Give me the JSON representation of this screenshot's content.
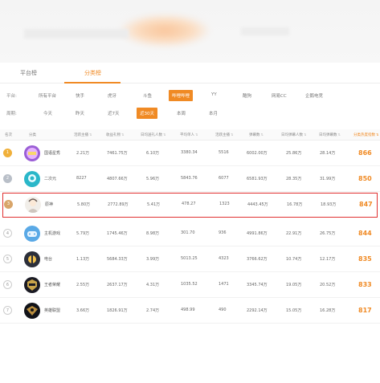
{
  "tabs": [
    {
      "label": "平台榜"
    },
    {
      "label": "分类榜"
    }
  ],
  "platform_filter": {
    "label": "平台:",
    "options": [
      "所有平台",
      "快手",
      "虎牙",
      "斗鱼",
      "哔哩哔哩",
      "YY",
      "酷狗",
      "网易CC",
      "企鹅电竞"
    ],
    "active_index": 4
  },
  "period_filter": {
    "label": "周期:",
    "options": [
      "今天",
      "昨天",
      "近7天",
      "近30天",
      "本周",
      "本月"
    ],
    "active_index": 3
  },
  "table": {
    "columns": [
      "名次",
      "分类",
      "活跃主播",
      "收益礼物",
      "日均送礼人数",
      "平均单人",
      "活跃主播",
      "弹幕数",
      "日均弹幕人数",
      "日均弹幕数",
      "分类热度指数"
    ],
    "rows": [
      {
        "rank": "1",
        "name": "国语星秀",
        "c1": "2.21万",
        "c2": "7461.75万",
        "c3": "6.10万",
        "c4": "3380.34",
        "c5": "5516",
        "c6": "6002.00万",
        "c7": "25.86万",
        "c8": "28.14万",
        "score": "866",
        "thumb": "xingxiu"
      },
      {
        "rank": "2",
        "name": "二次元",
        "c1": "8227",
        "c2": "4807.66万",
        "c3": "5.96万",
        "c4": "5843.76",
        "c5": "6077",
        "c6": "6581.93万",
        "c7": "28.35万",
        "c8": "31.99万",
        "score": "850",
        "thumb": "erciyuan"
      },
      {
        "rank": "3",
        "name": "原神",
        "c1": "5.80万",
        "c2": "2772.89万",
        "c3": "5.41万",
        "c4": "478.27",
        "c5": "1323",
        "c6": "4443.45万",
        "c7": "16.78万",
        "c8": "18.93万",
        "score": "847",
        "thumb": "yuanshen"
      },
      {
        "rank": "4",
        "name": "主机游戏",
        "c1": "5.79万",
        "c2": "1745.46万",
        "c3": "8.98万",
        "c4": "301.70",
        "c5": "936",
        "c6": "4991.86万",
        "c7": "22.91万",
        "c8": "26.75万",
        "score": "844",
        "thumb": "zhuji"
      },
      {
        "rank": "5",
        "name": "电台",
        "c1": "1.13万",
        "c2": "5684.33万",
        "c3": "3.99万",
        "c4": "5013.25",
        "c5": "4323",
        "c6": "3766.62万",
        "c7": "10.74万",
        "c8": "12.17万",
        "score": "835",
        "thumb": "diantai"
      },
      {
        "rank": "6",
        "name": "王者荣耀",
        "c1": "2.55万",
        "c2": "2637.17万",
        "c3": "4.31万",
        "c4": "1035.52",
        "c5": "1471",
        "c6": "3345.74万",
        "c7": "19.05万",
        "c8": "20.52万",
        "score": "833",
        "thumb": "wangzhe"
      },
      {
        "rank": "7",
        "name": "英雄联盟",
        "c1": "3.66万",
        "c2": "1826.91万",
        "c3": "2.74万",
        "c4": "498.99",
        "c5": "490",
        "c6": "2292.14万",
        "c7": "15.05万",
        "c8": "16.28万",
        "score": "817",
        "thumb": "lol"
      }
    ]
  },
  "colors": {
    "accent": "#f08a24",
    "highlight_border": "#e03030"
  }
}
